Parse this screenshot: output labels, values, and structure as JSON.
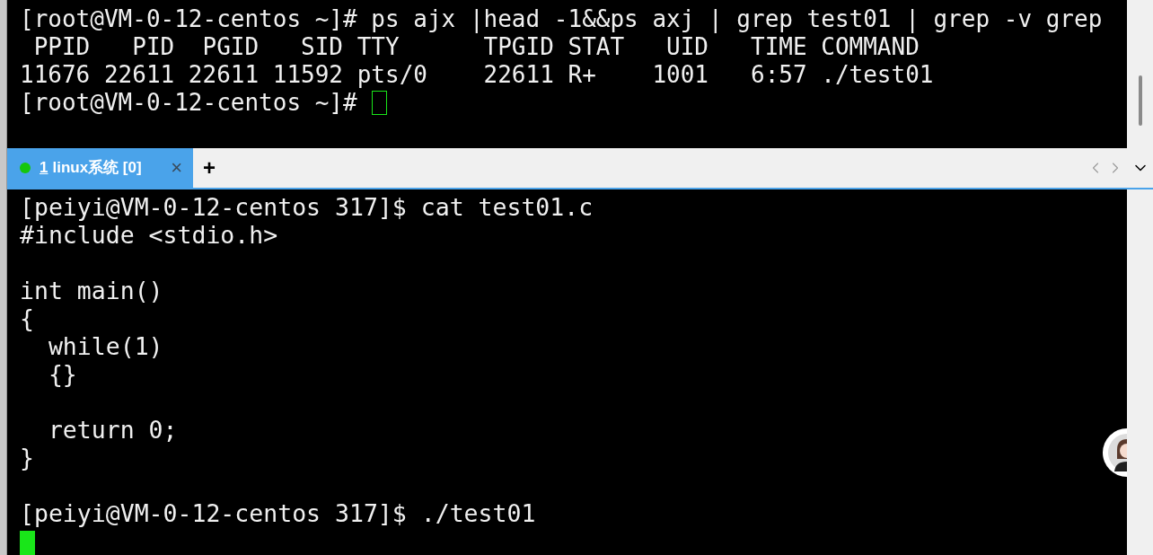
{
  "top_terminal": {
    "lines": [
      {
        "kind": "text",
        "text": "[root@VM-0-12-centos ~]# ps ajx |head -1&&ps axj | grep test01 | grep -v grep"
      },
      {
        "kind": "text",
        "text": " PPID   PID  PGID   SID TTY      TPGID STAT   UID   TIME COMMAND"
      },
      {
        "kind": "text",
        "text": "11676 22611 22611 11592 pts/0    22611 R+    1001   6:57 ./test01"
      },
      {
        "kind": "input",
        "text": "[root@VM-0-12-centos ~]#"
      }
    ],
    "cursor": {
      "focused": false
    }
  },
  "tabs": [
    {
      "number": "1",
      "label": "linux系统 [0]",
      "selected": true,
      "color": "#16c60c",
      "close": "×"
    }
  ],
  "add_tab": "+",
  "bottom_terminal": {
    "lines": [
      {
        "kind": "text",
        "text": "[peiyi@VM-0-12-centos 317]$ cat test01.c"
      },
      {
        "kind": "text",
        "text": "#include <stdio.h>"
      },
      {
        "kind": "blank"
      },
      {
        "kind": "text",
        "text": "int main()"
      },
      {
        "kind": "text",
        "text": "{"
      },
      {
        "kind": "text",
        "text": "  while(1)"
      },
      {
        "kind": "text",
        "text": "  {}"
      },
      {
        "kind": "blank"
      },
      {
        "kind": "text",
        "text": "  return 0;"
      },
      {
        "kind": "text",
        "text": "}"
      },
      {
        "kind": "blank"
      },
      {
        "kind": "text",
        "text": "[peiyi@VM-0-12-centos 317]$ ./test01"
      },
      {
        "kind": "cursor"
      }
    ],
    "cursor": {
      "focused": true
    }
  }
}
